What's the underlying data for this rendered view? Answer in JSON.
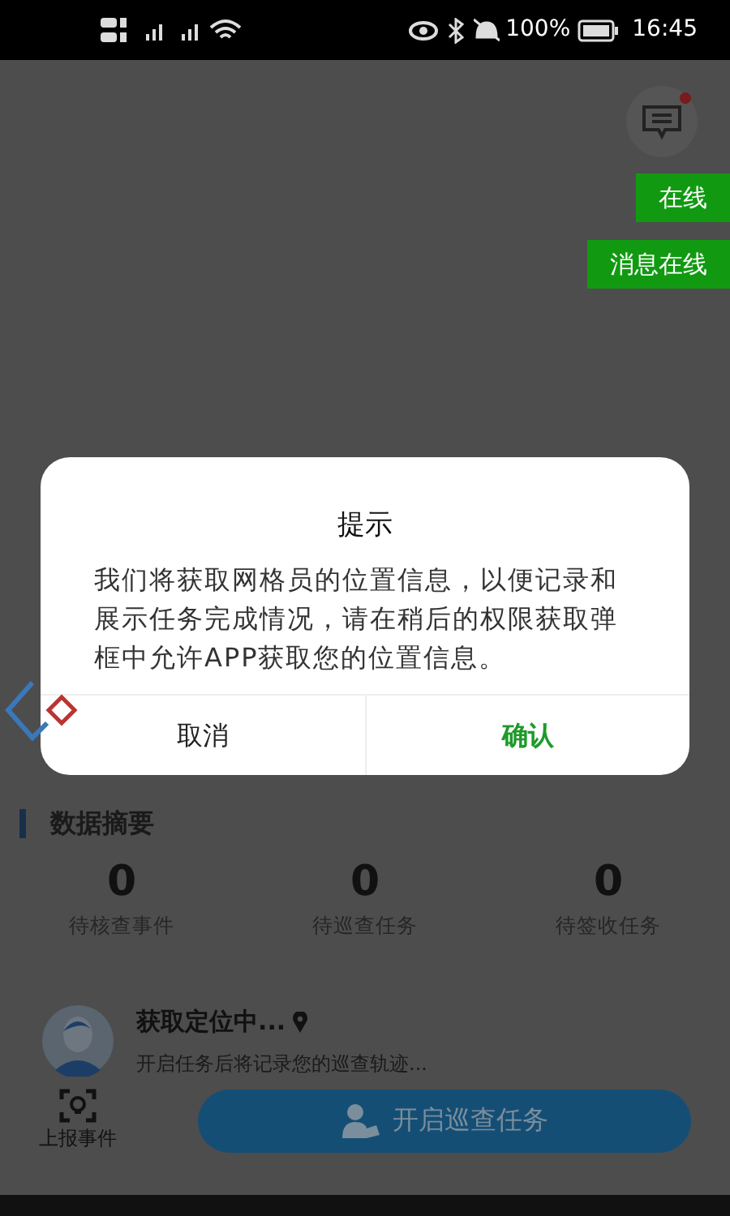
{
  "status_bar": {
    "battery": "100%",
    "time": "16:45"
  },
  "message_button": {
    "unread": true
  },
  "status_badges": [
    {
      "label": "在线"
    },
    {
      "label": "消息在线"
    }
  ],
  "dialog": {
    "title": "提示",
    "message": "我们将获取网格员的位置信息，以便记录和展示任务完成情况，请在稍后的权限获取弹框中允许APP获取您的位置信息。",
    "buttons": [
      {
        "label": "取消",
        "kind": "cancel"
      },
      {
        "label": "确认",
        "kind": "confirm"
      }
    ]
  },
  "summary": {
    "title": "数据摘要",
    "stats": [
      {
        "value": "0",
        "label": "待核查事件"
      },
      {
        "value": "0",
        "label": "待巡查任务"
      },
      {
        "value": "0",
        "label": "待签收任务"
      }
    ]
  },
  "location": {
    "title": "获取定位中...",
    "subtitle": "开启任务后将记录您的巡查轨迹..."
  },
  "report_button": {
    "label": "上报事件"
  },
  "start_button": {
    "label": "开启巡查任务"
  }
}
